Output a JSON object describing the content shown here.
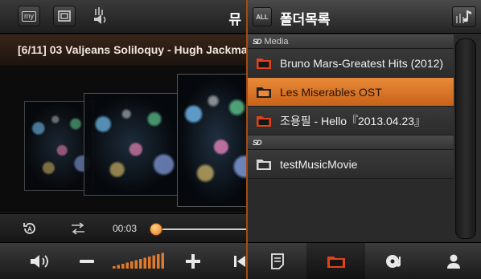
{
  "colors": {
    "accent": "#e07a2a",
    "selected_row": "#d8722a",
    "folder_icon": "#e0431a"
  },
  "player": {
    "header": {
      "my_label": "my",
      "title_fragment": "뮤"
    },
    "track_title": "[6/11] 03 Valjeans Soliloquy - Hugh Jackman",
    "elapsed_time": "00:03",
    "progress_fraction": 0.02,
    "volume_level_bars": 8
  },
  "folder_panel": {
    "all_label": "ALL",
    "title": "폴더목록",
    "sections": [
      {
        "label": "Media",
        "badge": "SD",
        "items": [
          {
            "label": "Bruno Mars-Greatest Hits (2012)",
            "icon": "folder-icon",
            "selected": false
          },
          {
            "label": "Les Miserables OST",
            "icon": "folder-icon",
            "selected": true
          },
          {
            "label": "조용필 - Hello『2013.04.23』",
            "icon": "folder-icon",
            "selected": false
          }
        ]
      },
      {
        "label": "",
        "badge": "SD",
        "items": [
          {
            "label": "testMusicMovie",
            "icon": "folder-icon",
            "selected": false
          }
        ]
      }
    ],
    "tabs": [
      {
        "icon": "document-icon",
        "active": false
      },
      {
        "icon": "folder-icon",
        "active": true
      },
      {
        "icon": "music-disc-icon",
        "active": false
      },
      {
        "icon": "person-icon",
        "active": false
      }
    ]
  }
}
